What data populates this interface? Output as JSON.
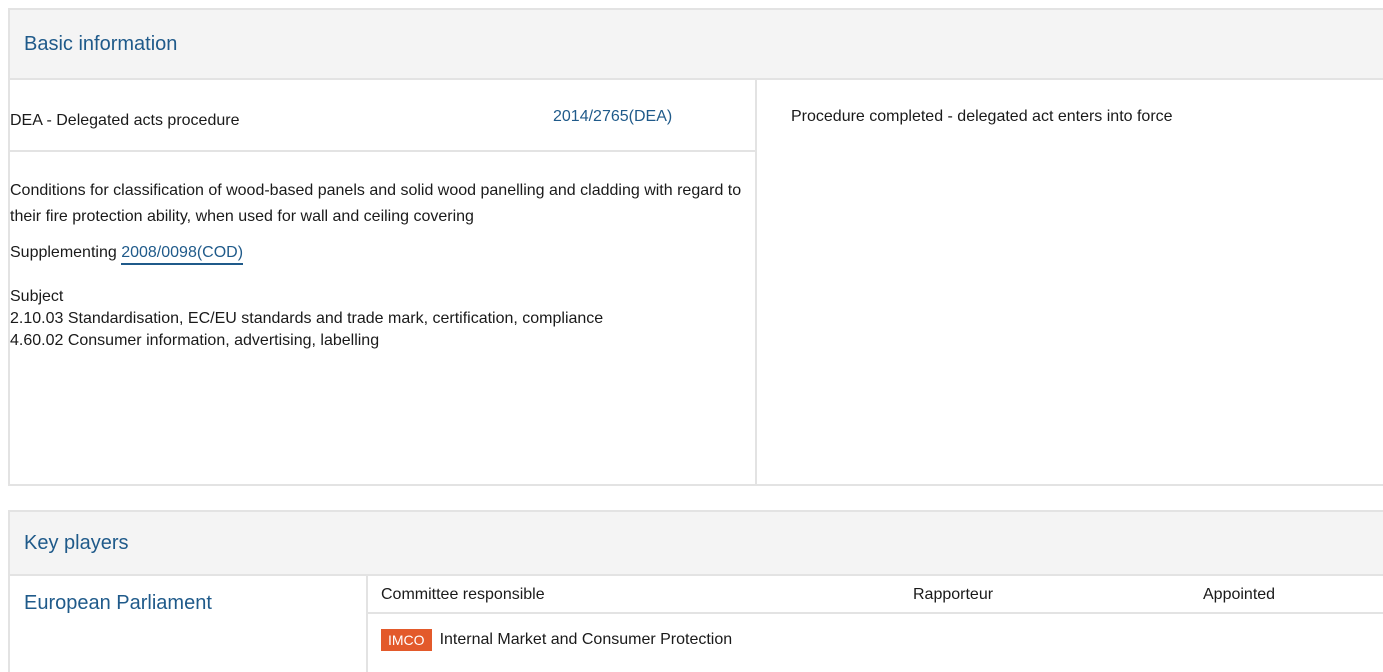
{
  "basic_information": {
    "title": "Basic information",
    "procedure_type": "DEA - Delegated acts procedure",
    "procedure_reference": "2014/2765(DEA)",
    "status": "Procedure completed - delegated act enters into force",
    "procedure_title": "Conditions for classification of wood-based panels and solid wood panelling and cladding with regard to their fire protection ability, when used for wall and ceiling covering",
    "supplementing_label": "Supplementing",
    "supplementing_link": "2008/0098(COD)",
    "subject_label": "Subject",
    "subjects": [
      "2.10.03 Standardisation, EC/EU standards and trade mark, certification, compliance",
      "4.60.02 Consumer information, advertising, labelling"
    ]
  },
  "key_players": {
    "title": "Key players",
    "institution": "European Parliament",
    "columns": {
      "committee": "Committee responsible",
      "rapporteur": "Rapporteur",
      "appointed": "Appointed"
    },
    "committee": {
      "badge": "IMCO",
      "name": "Internal Market and Consumer Protection",
      "badge_color": "#e35a2b"
    }
  },
  "colors": {
    "link": "#1f5a8a",
    "border": "#e3e3e3",
    "header_bg": "#f4f4f4"
  }
}
